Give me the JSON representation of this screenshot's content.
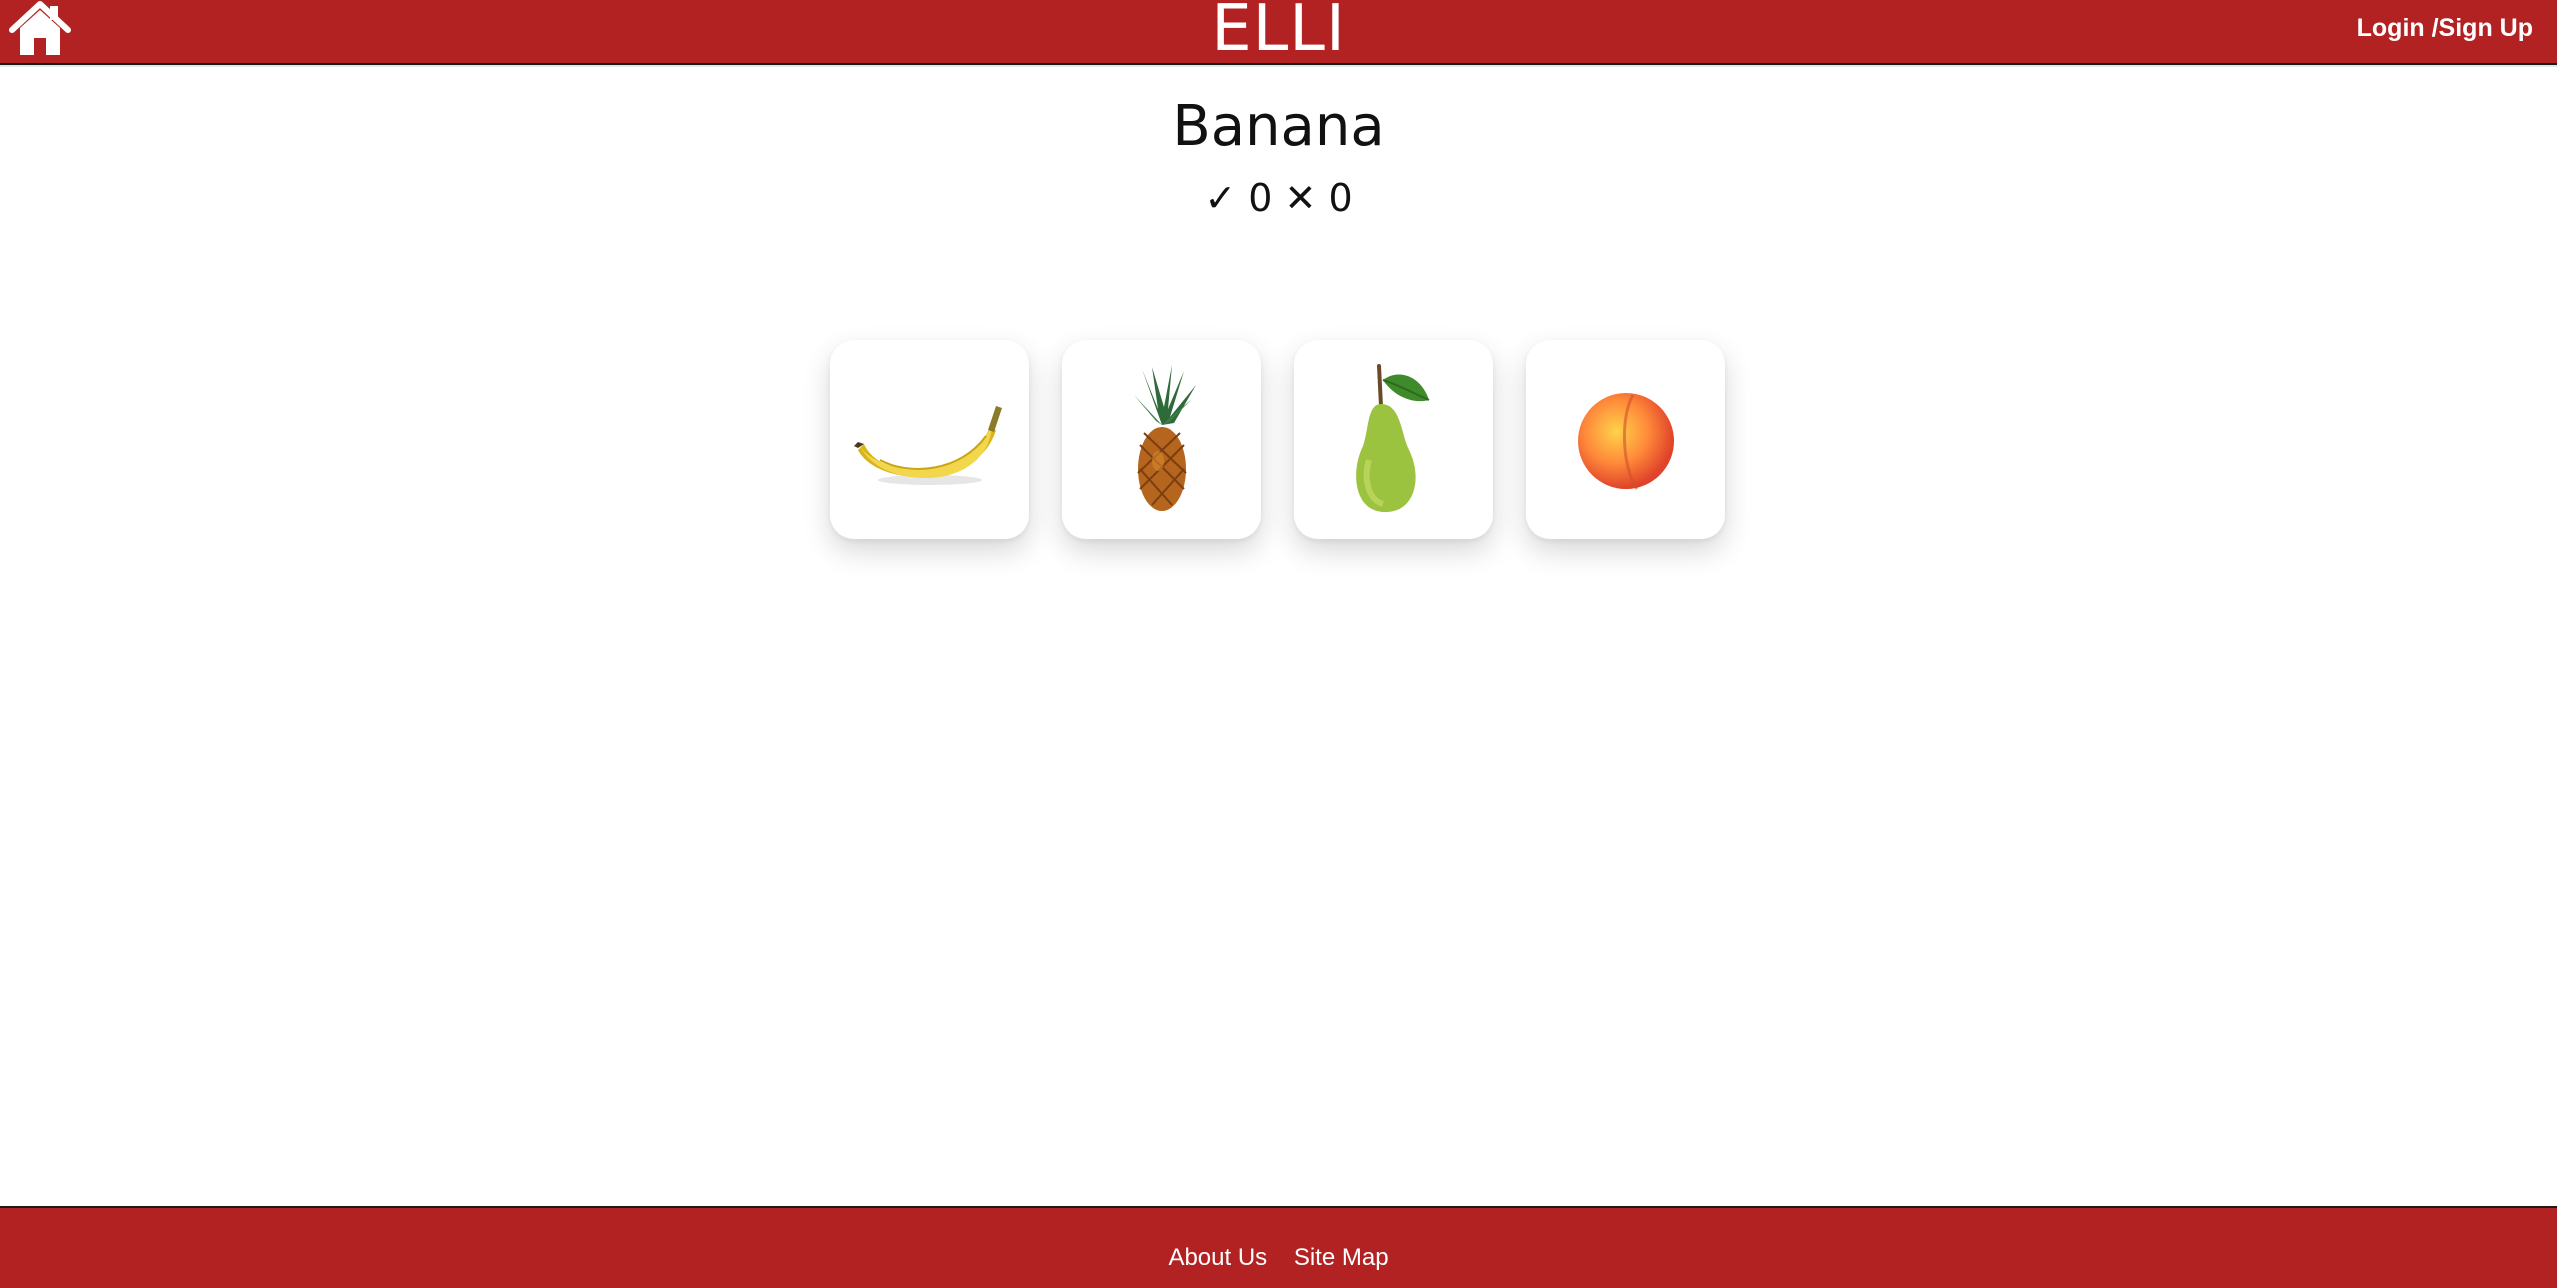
{
  "header": {
    "brand": "ELLI",
    "login_label": "Login /Sign Up",
    "home_icon": "home-icon"
  },
  "quiz": {
    "word": "Banana",
    "correct_symbol": "✓",
    "correct_count": "0",
    "wrong_symbol": "✕",
    "wrong_count": "0",
    "options": [
      {
        "icon": "banana-icon"
      },
      {
        "icon": "pineapple-icon"
      },
      {
        "icon": "pear-icon"
      },
      {
        "icon": "peach-icon"
      }
    ]
  },
  "footer": {
    "links": [
      "About Us",
      "Site Map"
    ]
  },
  "colors": {
    "brand_red": "#b22222",
    "background": "#ffffff"
  }
}
